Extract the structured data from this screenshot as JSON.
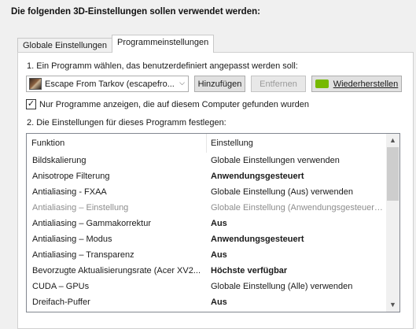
{
  "header": {
    "title": "Die folgenden 3D-Einstellungen sollen verwendet werden:"
  },
  "tabs": [
    {
      "label": "Globale Einstellungen",
      "active": false
    },
    {
      "label": "Programmeinstellungen",
      "active": true
    }
  ],
  "program": {
    "step1_label": "1. Ein Programm wählen, das benutzerdefiniert angepasst werden soll:",
    "selected": "Escape From Tarkov (escapefro...",
    "add_label": "Hinzufügen",
    "remove_label": "Entfernen",
    "restore_label": "Wiederherstellen",
    "only_found_checkbox": {
      "label": "Nur Programme anzeigen, die auf diesem Computer gefunden wurden",
      "checked": true
    }
  },
  "settings": {
    "step2_label": "2. Die Einstellungen für dieses Programm festlegen:",
    "columns": [
      "Funktion",
      "Einstellung"
    ],
    "rows": [
      {
        "feature": "Bildskalierung",
        "value": "Globale Einstellungen verwenden",
        "bold": false,
        "disabled": false
      },
      {
        "feature": "Anisotrope Filterung",
        "value": "Anwendungsgesteuert",
        "bold": true,
        "disabled": false
      },
      {
        "feature": "Antialiasing - FXAA",
        "value": "Globale Einstellung (Aus) verwenden",
        "bold": false,
        "disabled": false
      },
      {
        "feature": "Antialiasing – Einstellung",
        "value": "Globale Einstellung (Anwendungsgesteuer…",
        "bold": false,
        "disabled": true
      },
      {
        "feature": "Antialiasing – Gammakorrektur",
        "value": "Aus",
        "bold": true,
        "disabled": false
      },
      {
        "feature": "Antialiasing – Modus",
        "value": "Anwendungsgesteuert",
        "bold": true,
        "disabled": false
      },
      {
        "feature": "Antialiasing – Transparenz",
        "value": "Aus",
        "bold": true,
        "disabled": false
      },
      {
        "feature": "Bevorzugte Aktualisierungsrate (Acer XV2...",
        "value": "Höchste verfügbar",
        "bold": true,
        "disabled": false
      },
      {
        "feature": "CUDA – GPUs",
        "value": "Globale Einstellung (Alle) verwenden",
        "bold": false,
        "disabled": false
      },
      {
        "feature": "Dreifach-Puffer",
        "value": "Aus",
        "bold": true,
        "disabled": false
      }
    ],
    "scroll_position": 0
  },
  "icons": {
    "combo_chevron": "chevron-down-icon",
    "restore": "nvidia-icon",
    "scroll_up": "chevron-up-icon",
    "scroll_down": "chevron-down-icon",
    "check": "checkmark-icon"
  },
  "colors": {
    "nvidia_green": "#76b900",
    "disabled_text": "#8d8d8d"
  }
}
